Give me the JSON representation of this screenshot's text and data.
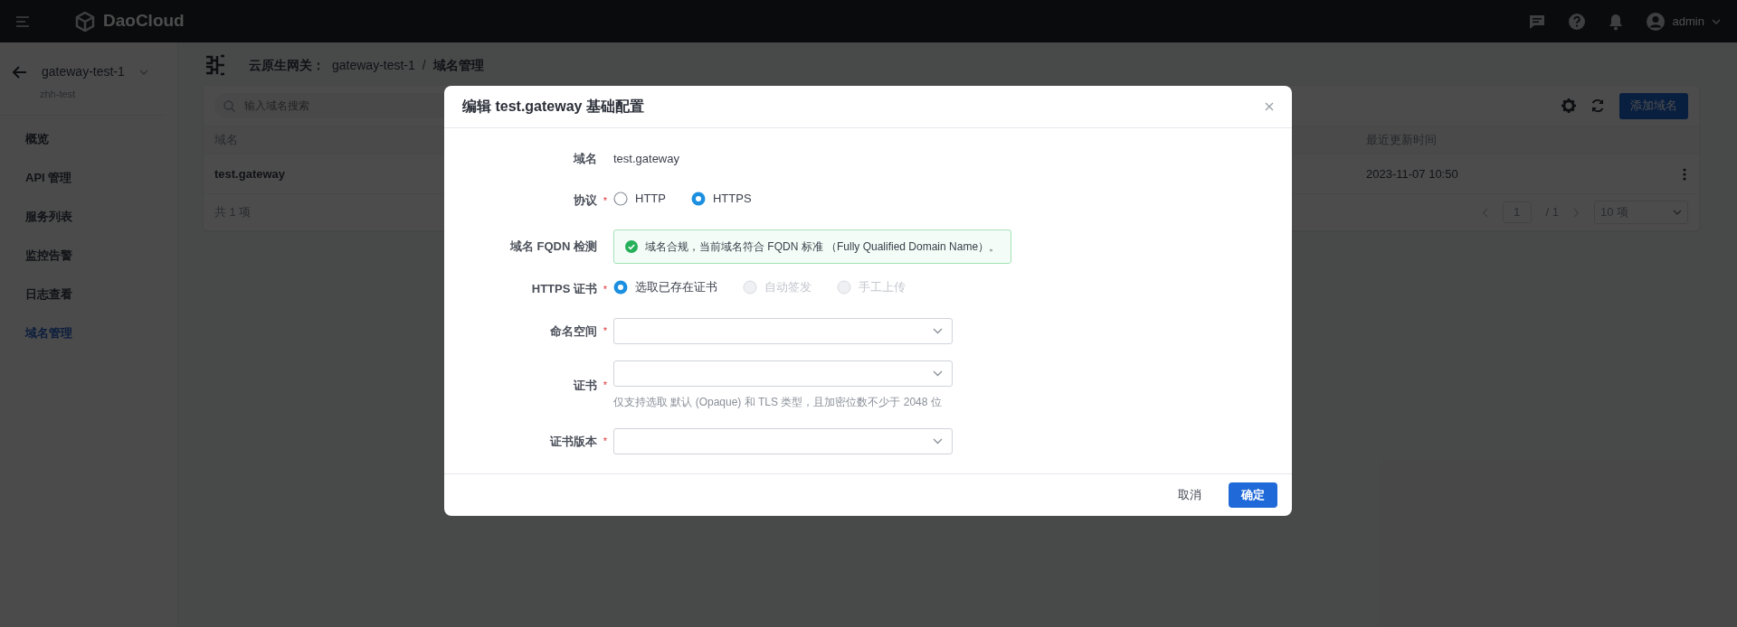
{
  "topbar": {
    "brand": "DaoCloud",
    "user": "admin"
  },
  "sidebar": {
    "gateway": "gateway-test-1",
    "namespace": "zhh-test",
    "items": [
      {
        "label": "概览",
        "selected": false
      },
      {
        "label": "API 管理",
        "selected": false
      },
      {
        "label": "服务列表",
        "selected": false
      },
      {
        "label": "监控告警",
        "selected": false
      },
      {
        "label": "日志查看",
        "selected": false
      },
      {
        "label": "域名管理",
        "selected": true
      }
    ]
  },
  "breadcrumb": {
    "section": "云原生网关：",
    "items": [
      "gateway-test-1",
      "域名管理"
    ],
    "separator": "/"
  },
  "toolbar": {
    "search": {
      "placeholder": "输入域名搜索"
    },
    "add_button": "添加域名"
  },
  "table": {
    "columns": [
      "域名",
      "最近更新时间"
    ],
    "rows": [
      {
        "domain": "test.gateway",
        "updated": "2023-11-07 10:50"
      }
    ],
    "total": "共 1 项",
    "page": "1",
    "page_count": "/ 1",
    "page_size": "10 项"
  },
  "dialog": {
    "title": "编辑 test.gateway 基础配置",
    "fields": [
      {
        "kind": "text",
        "label": "域名",
        "value": "test.gateway"
      },
      {
        "kind": "radio",
        "label": "协议",
        "required_mark": "*",
        "options": [
          {
            "label": "HTTP",
            "selected": false,
            "disabled": false
          },
          {
            "label": "HTTPS",
            "selected": true,
            "disabled": false
          }
        ]
      },
      {
        "kind": "alert",
        "label": "域名 FQDN 检测",
        "message": "域名合规，当前域名符合 FQDN 标准 （Fully Qualified Domain Name）。"
      },
      {
        "kind": "radio",
        "label": "HTTPS 证书",
        "required_mark": "*",
        "options": [
          {
            "label": "选取已存在证书",
            "selected": true,
            "disabled": false
          },
          {
            "label": "自动签发",
            "selected": false,
            "disabled": true
          },
          {
            "label": "手工上传",
            "selected": false,
            "disabled": true
          }
        ]
      },
      {
        "kind": "select",
        "label": "命名空间",
        "required_mark": "*"
      },
      {
        "kind": "select",
        "label": "证书",
        "required_mark": "*",
        "hint": "仅支持选取 默认 (Opaque) 和 TLS 类型，且加密位数不少于 2048 位"
      },
      {
        "kind": "select",
        "label": "证书版本",
        "required_mark": "*"
      }
    ],
    "buttons": {
      "cancel": "取消",
      "confirm": "确定"
    }
  }
}
